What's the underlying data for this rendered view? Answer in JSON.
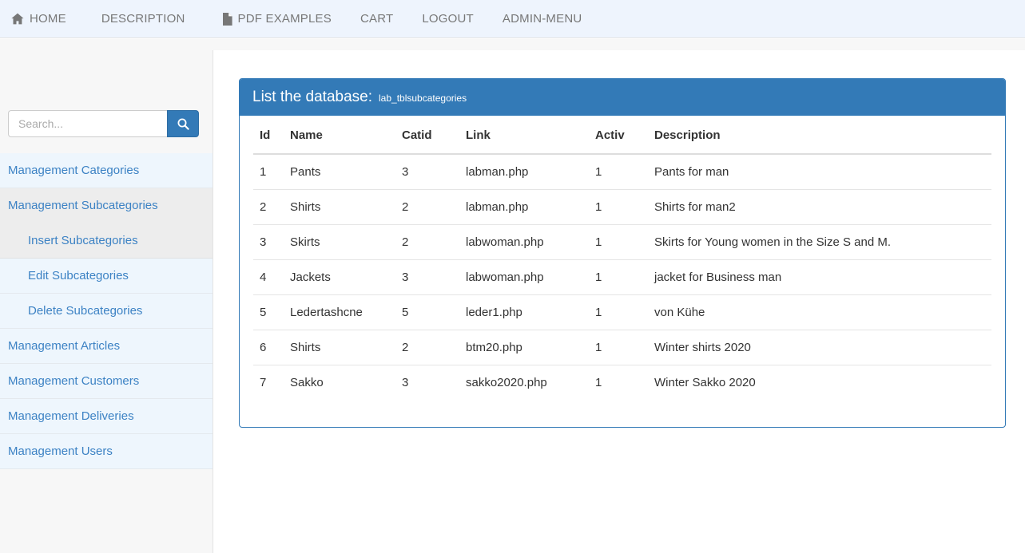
{
  "navbar": {
    "items": [
      {
        "label": "HOME",
        "icon": "home-icon"
      },
      {
        "label": "DESCRIPTION",
        "icon": null
      },
      {
        "label": "PDF EXAMPLES",
        "icon": "file-icon"
      },
      {
        "label": "CART",
        "icon": null
      },
      {
        "label": "LOGOUT",
        "icon": null
      },
      {
        "label": "ADMIN-MENU",
        "icon": null
      }
    ]
  },
  "sidebar": {
    "search": {
      "placeholder": "Search...",
      "value": "",
      "button_icon": "search-icon"
    },
    "items": [
      {
        "label": "Management Categories",
        "sub": false,
        "active": false
      },
      {
        "label": "Management Subcategories",
        "sub": false,
        "active": true
      },
      {
        "label": "Insert Subcategories",
        "sub": true,
        "active": true
      },
      {
        "label": "Edit Subcategories",
        "sub": true,
        "active": false
      },
      {
        "label": "Delete Subcategories",
        "sub": true,
        "active": false
      },
      {
        "label": "Management Articles",
        "sub": false,
        "active": false
      },
      {
        "label": "Management Customers",
        "sub": false,
        "active": false
      },
      {
        "label": "Management Deliveries",
        "sub": false,
        "active": false
      },
      {
        "label": "Management Users",
        "sub": false,
        "active": false
      }
    ]
  },
  "panel": {
    "title": "List the database:",
    "subtitle": "lab_tblsubcategories",
    "table": {
      "headers": [
        "Id",
        "Name",
        "Catid",
        "Link",
        "Activ",
        "Description"
      ],
      "rows": [
        [
          "1",
          "Pants",
          "3",
          "labman.php",
          "1",
          "Pants for man"
        ],
        [
          "2",
          "Shirts",
          "2",
          "labman.php",
          "1",
          "Shirts for man2"
        ],
        [
          "3",
          "Skirts",
          "2",
          "labwoman.php",
          "1",
          "Skirts for Young women in the Size S and M."
        ],
        [
          "4",
          "Jackets",
          "3",
          "labwoman.php",
          "1",
          "jacket for Business man"
        ],
        [
          "5",
          "Ledertashcne",
          "5",
          "leder1.php",
          "1",
          "von Kühe"
        ],
        [
          "6",
          "Shirts",
          "2",
          "btm20.php",
          "1",
          "Winter shirts 2020"
        ],
        [
          "7",
          "Sakko",
          "3",
          "sakko2020.php",
          "1",
          "Winter Sakko 2020"
        ]
      ]
    }
  },
  "colors": {
    "navbar_bg": "#eef4fd",
    "panel_blue": "#337ab7",
    "sidebar_item_bg": "#eef6fd",
    "sidebar_active_bg": "#ededed",
    "link_blue": "#3c82c4"
  }
}
